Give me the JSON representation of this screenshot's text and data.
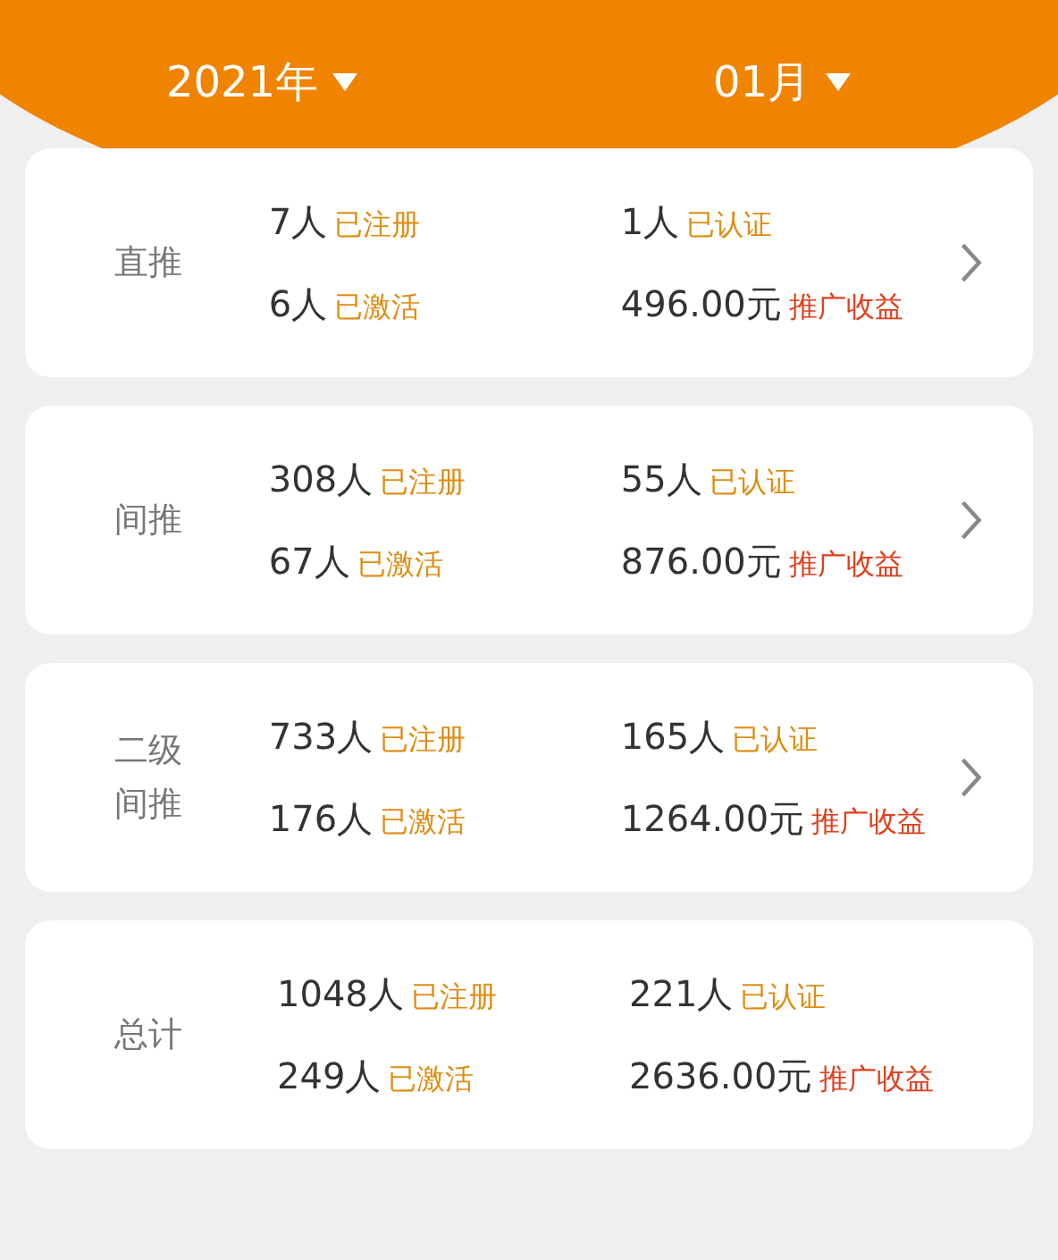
{
  "header": {
    "year": {
      "label": "2021年"
    },
    "month": {
      "label": "01月"
    }
  },
  "cards": [
    {
      "label": "直推",
      "has_arrow": true,
      "stats": [
        {
          "value": "7人",
          "tag": "已注册",
          "kind": "count"
        },
        {
          "value": "1人",
          "tag": "已认证",
          "kind": "count"
        },
        {
          "value": "6人",
          "tag": "已激活",
          "kind": "count"
        },
        {
          "value": "496.00元",
          "tag": "推广收益",
          "kind": "income"
        }
      ]
    },
    {
      "label": "间推",
      "has_arrow": true,
      "stats": [
        {
          "value": "308人",
          "tag": "已注册",
          "kind": "count"
        },
        {
          "value": "55人",
          "tag": "已认证",
          "kind": "count"
        },
        {
          "value": "67人",
          "tag": "已激活",
          "kind": "count"
        },
        {
          "value": "876.00元",
          "tag": "推广收益",
          "kind": "income"
        }
      ]
    },
    {
      "label": "二级间推",
      "has_arrow": true,
      "stats": [
        {
          "value": "733人",
          "tag": "已注册",
          "kind": "count"
        },
        {
          "value": "165人",
          "tag": "已认证",
          "kind": "count"
        },
        {
          "value": "176人",
          "tag": "已激活",
          "kind": "count"
        },
        {
          "value": "1264.00元",
          "tag": "推广收益",
          "kind": "income"
        }
      ]
    },
    {
      "label": "总计",
      "has_arrow": false,
      "stats": [
        {
          "value": "1048人",
          "tag": "已注册",
          "kind": "count"
        },
        {
          "value": "221人",
          "tag": "已认证",
          "kind": "count"
        },
        {
          "value": "249人",
          "tag": "已激活",
          "kind": "count"
        },
        {
          "value": "2636.00元",
          "tag": "推广收益",
          "kind": "income"
        }
      ]
    }
  ]
}
